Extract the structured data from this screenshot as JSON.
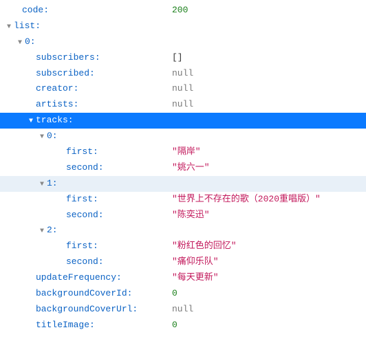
{
  "root": {
    "code": {
      "label": "code:",
      "value": "200",
      "type": "num"
    },
    "list": {
      "label": "list:"
    },
    "item0": {
      "label": "0:",
      "subscribers": {
        "label": "subscribers:",
        "value": "[]",
        "type": "punct"
      },
      "subscribed": {
        "label": "subscribed:",
        "value": "null",
        "type": "null"
      },
      "creator": {
        "label": "creator:",
        "value": "null",
        "type": "null"
      },
      "artists": {
        "label": "artists:",
        "value": "null",
        "type": "null"
      },
      "tracks": {
        "label": "tracks:"
      },
      "track0": {
        "label": "0:",
        "first": {
          "label": "first:",
          "value": "\"隔岸\"",
          "type": "str"
        },
        "second": {
          "label": "second:",
          "value": "\"姚六一\"",
          "type": "str"
        }
      },
      "track1": {
        "label": "1:",
        "first": {
          "label": "first:",
          "value": "\"世界上不存在的歌（2020重唱版）\"",
          "type": "str"
        },
        "second": {
          "label": "second:",
          "value": "\"陈奕迅\"",
          "type": "str"
        }
      },
      "track2": {
        "label": "2:",
        "first": {
          "label": "first:",
          "value": "\"粉红色的回忆\"",
          "type": "str"
        },
        "second": {
          "label": "second:",
          "value": "\"痛仰乐队\"",
          "type": "str"
        }
      },
      "updateFrequency": {
        "label": "updateFrequency:",
        "value": "\"每天更新\"",
        "type": "str"
      },
      "backgroundCoverId": {
        "label": "backgroundCoverId:",
        "value": "0",
        "type": "num"
      },
      "backgroundCoverUrl": {
        "label": "backgroundCoverUrl:",
        "value": "null",
        "type": "null"
      },
      "titleImage": {
        "label": "titleImage:",
        "value": "0",
        "type": "num"
      }
    }
  }
}
